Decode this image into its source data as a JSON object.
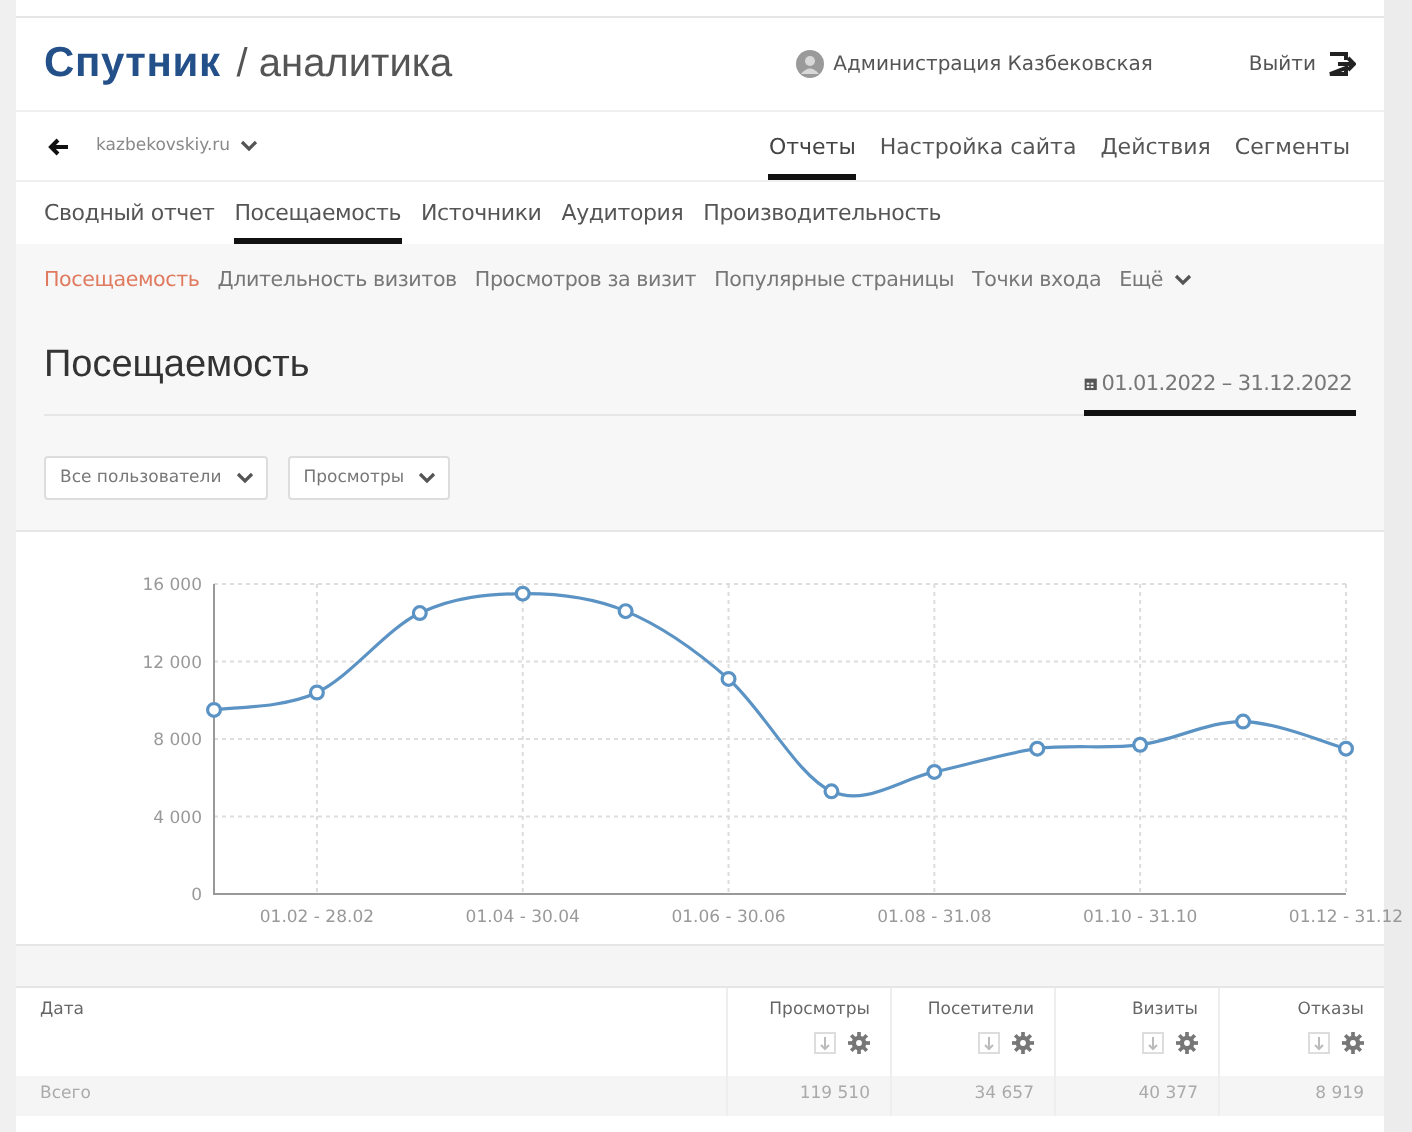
{
  "header": {
    "logo": "Спутник",
    "section": "/ аналитика",
    "user": "Администрация Казбековская",
    "logout": "Выйти"
  },
  "site": {
    "domain": "kazbekovskiy.ru"
  },
  "main_nav": [
    {
      "label": "Отчеты",
      "selected": true
    },
    {
      "label": "Настройка сайта",
      "selected": false
    },
    {
      "label": "Действия",
      "selected": false
    },
    {
      "label": "Сегменты",
      "selected": false
    }
  ],
  "report_tabs": [
    {
      "label": "Сводный отчет",
      "selected": false
    },
    {
      "label": "Посещаемость",
      "selected": true
    },
    {
      "label": "Источники",
      "selected": false
    },
    {
      "label": "Аудитория",
      "selected": false
    },
    {
      "label": "Производительность",
      "selected": false
    }
  ],
  "sub_tabs": [
    {
      "label": "Посещаемость",
      "selected": true
    },
    {
      "label": "Длительность визитов",
      "selected": false
    },
    {
      "label": "Просмотров за визит",
      "selected": false
    },
    {
      "label": "Популярные страницы",
      "selected": false
    },
    {
      "label": "Точки входа",
      "selected": false
    }
  ],
  "more": "Ещё",
  "page_title": "Посещаемость",
  "date_range": "01.01.2022 – 31.12.2022",
  "filters": [
    "Все пользователи",
    "Просмотры"
  ],
  "chart": {
    "chart_data": {
      "type": "line",
      "grid": true,
      "categories": [
        null,
        "01.02 - 28.02",
        null,
        "01.04 - 30.04",
        null,
        "01.06 - 30.06",
        null,
        "01.08 - 31.08",
        null,
        "01.10 - 31.10",
        null,
        "01.12 - 31.12"
      ],
      "ylim": [
        0,
        16000
      ],
      "yticks": [
        {
          "value": 0,
          "label": "0"
        },
        {
          "value": 4000,
          "label": "4 000"
        },
        {
          "value": 8000,
          "label": "8 000"
        },
        {
          "value": 12000,
          "label": "12 000"
        },
        {
          "value": 16000,
          "label": "16 000"
        }
      ],
      "series": [
        {
          "color": "#5b93c4",
          "marker": "circle",
          "values": [
            9500,
            10400,
            14500,
            15500,
            14600,
            11100,
            5300,
            6300,
            7500,
            7700,
            8900,
            7500
          ]
        }
      ]
    }
  },
  "table": {
    "columns": [
      "Дата",
      "Просмотры",
      "Посетители",
      "Визиты",
      "Отказы"
    ],
    "rows": [
      [
        "Всего",
        "119 510",
        "34 657",
        "40 377",
        "8 919"
      ]
    ]
  }
}
